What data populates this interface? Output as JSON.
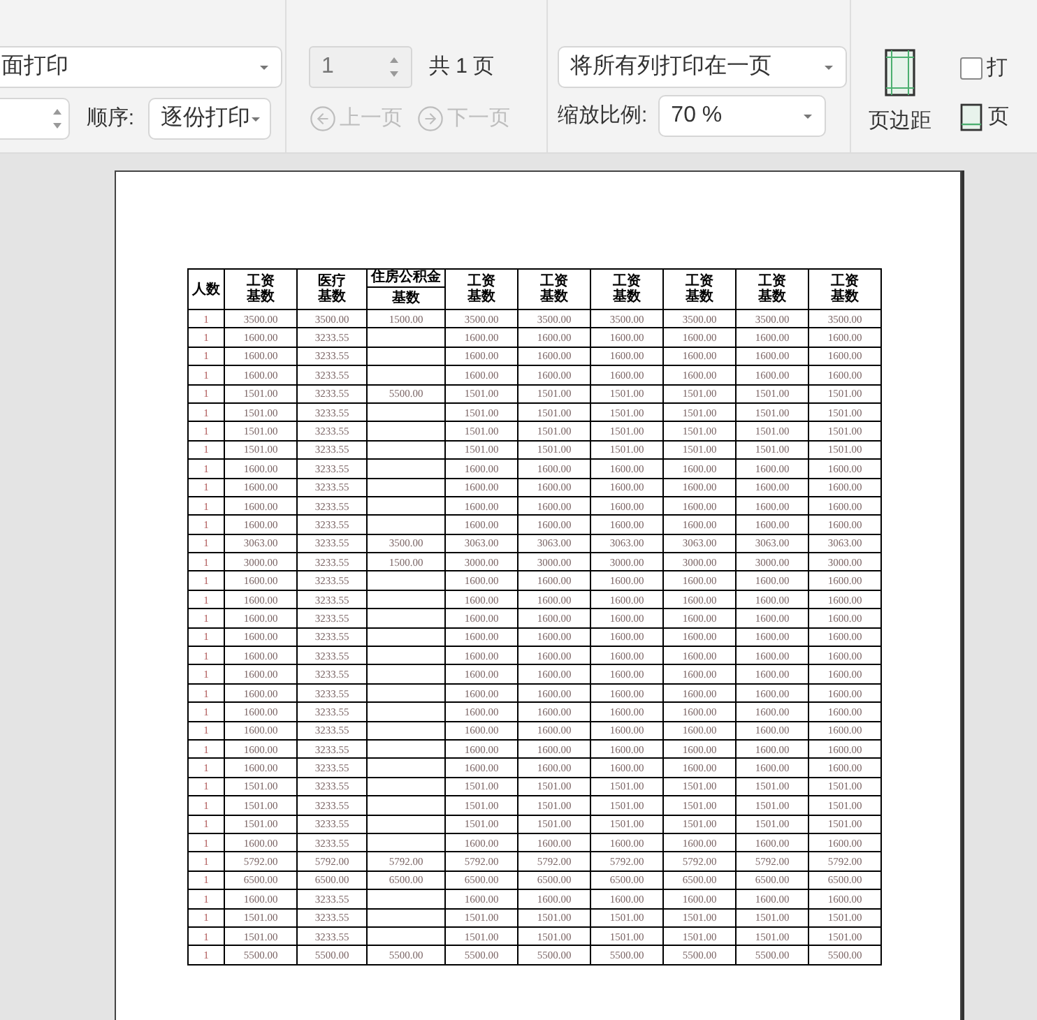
{
  "toolbar": {
    "print_mode": {
      "value": "面打印"
    },
    "order": {
      "label": "顺序:",
      "value": "逐份打印"
    },
    "page": {
      "value": "1",
      "disabled": true,
      "total": "共 1 页"
    },
    "nav": [
      {
        "label": "上一页",
        "disabled": true,
        "kind": "prev"
      },
      {
        "label": "下一页",
        "disabled": true,
        "kind": "next"
      }
    ],
    "fit": {
      "value": "将所有列打印在一页"
    },
    "zoom": {
      "label": "缩放比例:",
      "value": "70 %"
    },
    "margins": {
      "label": "页边距"
    },
    "print_option": {
      "label": "打",
      "checked": false
    },
    "header_footer": {
      "label": "页"
    }
  },
  "table": {
    "columns": [
      {
        "label": "人数"
      },
      {
        "label": "工资",
        "sub": "基数"
      },
      {
        "label": "医疗",
        "sub": "基数"
      },
      {
        "label": "住房公积金",
        "sub": "基数",
        "kind": "split"
      },
      {
        "label": "工资",
        "sub": "基数"
      },
      {
        "label": "工资",
        "sub": "基数"
      },
      {
        "label": "工资",
        "sub": "基数"
      },
      {
        "label": "工资",
        "sub": "基数"
      },
      {
        "label": "工资",
        "sub": "基数"
      },
      {
        "label": "工资",
        "sub": "基数"
      }
    ],
    "rows": [
      {
        "cells": [
          "1",
          "3500.00",
          "3500.00",
          "1500.00",
          "3500.00",
          "3500.00",
          "3500.00",
          "3500.00",
          "3500.00",
          "3500.00"
        ]
      },
      {
        "cells": [
          "1",
          "1600.00",
          "3233.55",
          null,
          "1600.00",
          "1600.00",
          "1600.00",
          "1600.00",
          "1600.00",
          "1600.00"
        ]
      },
      {
        "cells": [
          "1",
          "1600.00",
          "3233.55",
          null,
          "1600.00",
          "1600.00",
          "1600.00",
          "1600.00",
          "1600.00",
          "1600.00"
        ]
      },
      {
        "cells": [
          "1",
          "1600.00",
          "3233.55",
          null,
          "1600.00",
          "1600.00",
          "1600.00",
          "1600.00",
          "1600.00",
          "1600.00"
        ]
      },
      {
        "cells": [
          "1",
          "1501.00",
          "3233.55",
          "5500.00",
          "1501.00",
          "1501.00",
          "1501.00",
          "1501.00",
          "1501.00",
          "1501.00"
        ]
      },
      {
        "cells": [
          "1",
          "1501.00",
          "3233.55",
          null,
          "1501.00",
          "1501.00",
          "1501.00",
          "1501.00",
          "1501.00",
          "1501.00"
        ]
      },
      {
        "cells": [
          "1",
          "1501.00",
          "3233.55",
          null,
          "1501.00",
          "1501.00",
          "1501.00",
          "1501.00",
          "1501.00",
          "1501.00"
        ]
      },
      {
        "cells": [
          "1",
          "1501.00",
          "3233.55",
          null,
          "1501.00",
          "1501.00",
          "1501.00",
          "1501.00",
          "1501.00",
          "1501.00"
        ]
      },
      {
        "cells": [
          "1",
          "1600.00",
          "3233.55",
          null,
          "1600.00",
          "1600.00",
          "1600.00",
          "1600.00",
          "1600.00",
          "1600.00"
        ]
      },
      {
        "cells": [
          "1",
          "1600.00",
          "3233.55",
          null,
          "1600.00",
          "1600.00",
          "1600.00",
          "1600.00",
          "1600.00",
          "1600.00"
        ]
      },
      {
        "cells": [
          "1",
          "1600.00",
          "3233.55",
          null,
          "1600.00",
          "1600.00",
          "1600.00",
          "1600.00",
          "1600.00",
          "1600.00"
        ]
      },
      {
        "cells": [
          "1",
          "1600.00",
          "3233.55",
          null,
          "1600.00",
          "1600.00",
          "1600.00",
          "1600.00",
          "1600.00",
          "1600.00"
        ]
      },
      {
        "cells": [
          "1",
          "3063.00",
          "3233.55",
          "3500.00",
          "3063.00",
          "3063.00",
          "3063.00",
          "3063.00",
          "3063.00",
          "3063.00"
        ]
      },
      {
        "cells": [
          "1",
          "3000.00",
          "3233.55",
          "1500.00",
          "3000.00",
          "3000.00",
          "3000.00",
          "3000.00",
          "3000.00",
          "3000.00"
        ]
      },
      {
        "cells": [
          "1",
          "1600.00",
          "3233.55",
          null,
          "1600.00",
          "1600.00",
          "1600.00",
          "1600.00",
          "1600.00",
          "1600.00"
        ]
      },
      {
        "cells": [
          "1",
          "1600.00",
          "3233.55",
          null,
          "1600.00",
          "1600.00",
          "1600.00",
          "1600.00",
          "1600.00",
          "1600.00"
        ]
      },
      {
        "cells": [
          "1",
          "1600.00",
          "3233.55",
          null,
          "1600.00",
          "1600.00",
          "1600.00",
          "1600.00",
          "1600.00",
          "1600.00"
        ]
      },
      {
        "cells": [
          "1",
          "1600.00",
          "3233.55",
          null,
          "1600.00",
          "1600.00",
          "1600.00",
          "1600.00",
          "1600.00",
          "1600.00"
        ]
      },
      {
        "cells": [
          "1",
          "1600.00",
          "3233.55",
          null,
          "1600.00",
          "1600.00",
          "1600.00",
          "1600.00",
          "1600.00",
          "1600.00"
        ]
      },
      {
        "cells": [
          "1",
          "1600.00",
          "3233.55",
          null,
          "1600.00",
          "1600.00",
          "1600.00",
          "1600.00",
          "1600.00",
          "1600.00"
        ]
      },
      {
        "cells": [
          "1",
          "1600.00",
          "3233.55",
          null,
          "1600.00",
          "1600.00",
          "1600.00",
          "1600.00",
          "1600.00",
          "1600.00"
        ]
      },
      {
        "cells": [
          "1",
          "1600.00",
          "3233.55",
          null,
          "1600.00",
          "1600.00",
          "1600.00",
          "1600.00",
          "1600.00",
          "1600.00"
        ]
      },
      {
        "cells": [
          "1",
          "1600.00",
          "3233.55",
          null,
          "1600.00",
          "1600.00",
          "1600.00",
          "1600.00",
          "1600.00",
          "1600.00"
        ]
      },
      {
        "cells": [
          "1",
          "1600.00",
          "3233.55",
          null,
          "1600.00",
          "1600.00",
          "1600.00",
          "1600.00",
          "1600.00",
          "1600.00"
        ]
      },
      {
        "cells": [
          "1",
          "1600.00",
          "3233.55",
          null,
          "1600.00",
          "1600.00",
          "1600.00",
          "1600.00",
          "1600.00",
          "1600.00"
        ]
      },
      {
        "cells": [
          "1",
          "1501.00",
          "3233.55",
          null,
          "1501.00",
          "1501.00",
          "1501.00",
          "1501.00",
          "1501.00",
          "1501.00"
        ]
      },
      {
        "cells": [
          "1",
          "1501.00",
          "3233.55",
          null,
          "1501.00",
          "1501.00",
          "1501.00",
          "1501.00",
          "1501.00",
          "1501.00"
        ]
      },
      {
        "cells": [
          "1",
          "1501.00",
          "3233.55",
          null,
          "1501.00",
          "1501.00",
          "1501.00",
          "1501.00",
          "1501.00",
          "1501.00"
        ]
      },
      {
        "cells": [
          "1",
          "1600.00",
          "3233.55",
          null,
          "1600.00",
          "1600.00",
          "1600.00",
          "1600.00",
          "1600.00",
          "1600.00"
        ]
      },
      {
        "cells": [
          "1",
          "5792.00",
          "5792.00",
          "5792.00",
          "5792.00",
          "5792.00",
          "5792.00",
          "5792.00",
          "5792.00",
          "5792.00"
        ]
      },
      {
        "cells": [
          "1",
          "6500.00",
          "6500.00",
          "6500.00",
          "6500.00",
          "6500.00",
          "6500.00",
          "6500.00",
          "6500.00",
          "6500.00"
        ]
      },
      {
        "cells": [
          "1",
          "1600.00",
          "3233.55",
          null,
          "1600.00",
          "1600.00",
          "1600.00",
          "1600.00",
          "1600.00",
          "1600.00"
        ]
      },
      {
        "cells": [
          "1",
          "1501.00",
          "3233.55",
          null,
          "1501.00",
          "1501.00",
          "1501.00",
          "1501.00",
          "1501.00",
          "1501.00"
        ]
      },
      {
        "cells": [
          "1",
          "1501.00",
          "3233.55",
          null,
          "1501.00",
          "1501.00",
          "1501.00",
          "1501.00",
          "1501.00",
          "1501.00"
        ]
      },
      {
        "cells": [
          "1",
          "5500.00",
          "5500.00",
          "5500.00",
          "5500.00",
          "5500.00",
          "5500.00",
          "5500.00",
          "5500.00",
          "5500.00"
        ]
      }
    ]
  }
}
